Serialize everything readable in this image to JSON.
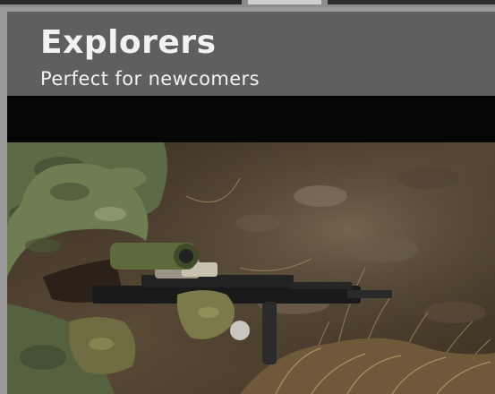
{
  "card": {
    "title": "Explorers",
    "subtitle": "Perfect for newcomers"
  },
  "photo": {
    "subject": "airsoft player in camouflage boonie hat aiming a rifle from grass"
  },
  "colors": {
    "page_bg": "#9a9a9a",
    "header_bg": "#5f5f5f",
    "band_bg": "#060606",
    "text": "#f2f2f2"
  }
}
